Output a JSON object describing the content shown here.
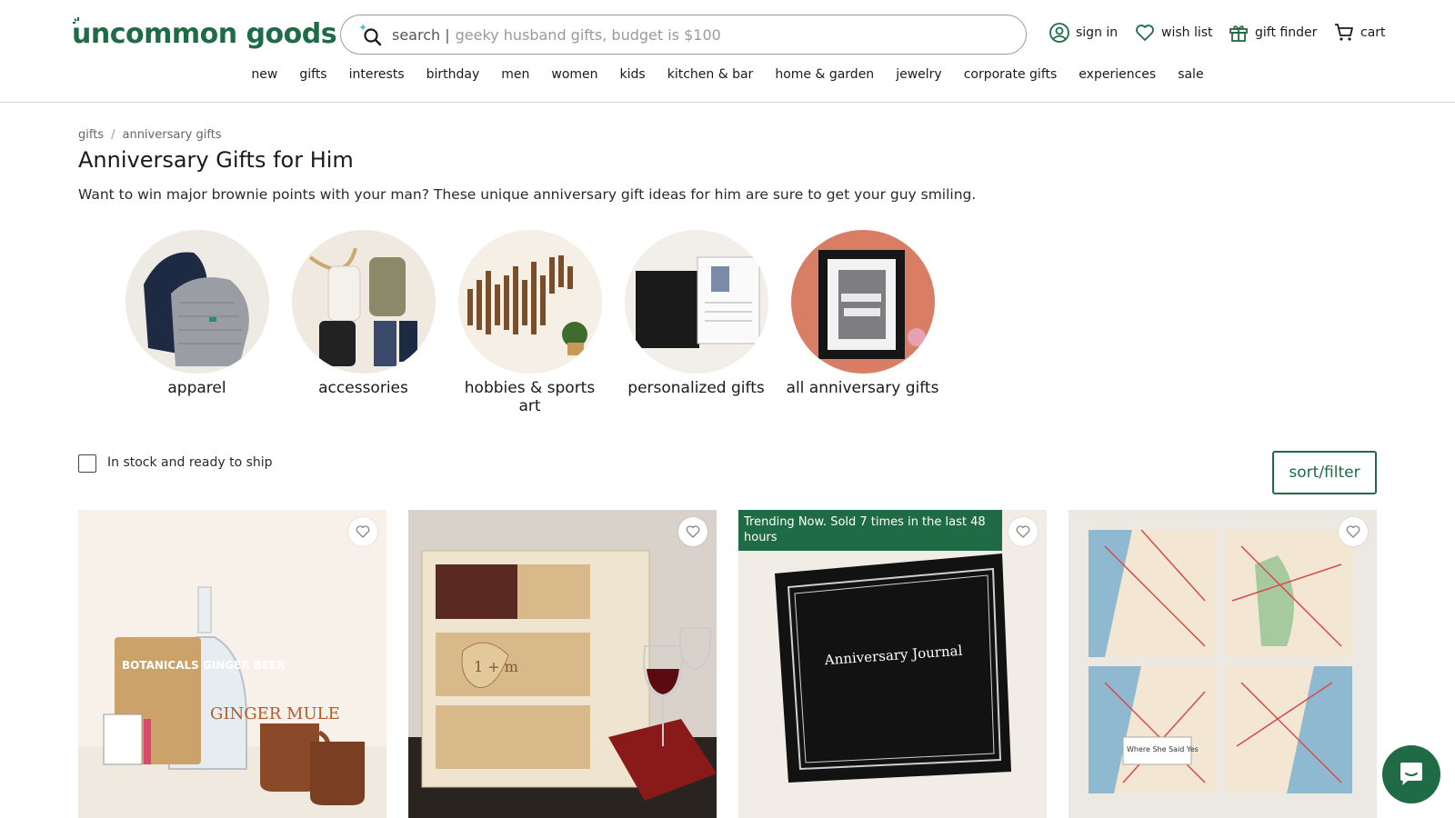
{
  "logo": {
    "text": "uncommon goods"
  },
  "search": {
    "label": "search |",
    "placeholder": "geeky husband gifts, budget is $100"
  },
  "utility": {
    "sign_in": "sign in",
    "wish_list": "wish list",
    "gift_finder": "gift finder",
    "cart": "cart"
  },
  "nav": [
    "new",
    "gifts",
    "interests",
    "birthday",
    "men",
    "women",
    "kids",
    "kitchen & bar",
    "home & garden",
    "jewelry",
    "corporate gifts",
    "experiences",
    "sale"
  ],
  "breadcrumb": {
    "items": [
      "gifts",
      "anniversary gifts"
    ],
    "separator": "/"
  },
  "page": {
    "title": "Anniversary Gifts for Him",
    "intro": "Want to win major brownie points with your man? These unique anniversary gift ideas for him are sure to get your guy smiling."
  },
  "categories": [
    {
      "label": "apparel"
    },
    {
      "label": "accessories"
    },
    {
      "label": "hobbies & sports art"
    },
    {
      "label": "personalized gifts"
    },
    {
      "label": "all anniversary gifts"
    }
  ],
  "filter": {
    "in_stock_label": "In stock and ready to ship",
    "sort_label": "sort/filter"
  },
  "products": [
    {
      "image_text": "BOTANICALS GINGER BEER",
      "image_text_2": "GINGER MULE"
    },
    {
      "image_text": "1 + m"
    },
    {
      "badge": "Trending Now. Sold 7 times in the last 48 hours",
      "image_text": "Anniversary Journal"
    },
    {
      "image_text": "Where She Said Yes"
    }
  ],
  "colors": {
    "brand_green": "#1f6b45",
    "border": "#d8d8d8"
  }
}
